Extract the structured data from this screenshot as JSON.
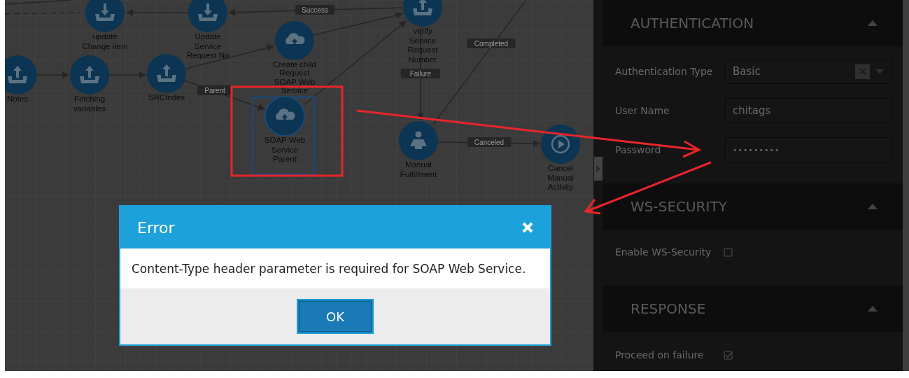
{
  "canvas": {
    "nodes": [
      {
        "label": [
          "update",
          "Change item"
        ],
        "kind": "download",
        "selected": false
      },
      {
        "label": [
          "Update",
          "Service",
          "Request No"
        ],
        "kind": "download",
        "selected": false
      },
      {
        "label": [
          "Notes"
        ],
        "kind": "upload",
        "selected": false
      },
      {
        "label": [
          "Fetching",
          "variables"
        ],
        "kind": "upload",
        "selected": false
      },
      {
        "label": [
          "SRCIndex"
        ],
        "kind": "upload",
        "selected": false
      },
      {
        "label": [
          "Create child",
          "Request",
          "SOAP Web",
          "Service"
        ],
        "kind": "cloud",
        "selected": false
      },
      {
        "label": [
          "SOAP Web",
          "Service",
          "Parent"
        ],
        "kind": "cloud",
        "selected": true
      },
      {
        "label": [
          "verify",
          "Service",
          "Request",
          "Number"
        ],
        "kind": "upload",
        "selected": false
      },
      {
        "label": [
          "Manual",
          "Fulfillment"
        ],
        "kind": "person",
        "selected": false
      },
      {
        "label": [
          "Cancel",
          "Manual",
          "Activity"
        ],
        "kind": "play",
        "selected": false
      }
    ],
    "edge_labels": [
      "Success",
      "Parent",
      "Completed",
      "Failure",
      "Canceled"
    ]
  },
  "dialog": {
    "title": "Error",
    "message": "Content-Type header parameter is required for SOAP Web Service.",
    "button": "OK"
  },
  "panel": {
    "sections": [
      {
        "title": "AUTHENTICATION",
        "expanded": true,
        "fields": [
          {
            "kind": "select",
            "label": "Authentication Type",
            "value": "Basic"
          },
          {
            "kind": "text",
            "label": "User Name",
            "value": "chitags"
          },
          {
            "kind": "password",
            "label": "Password",
            "value": "•••••••••"
          }
        ]
      },
      {
        "title": "WS-SECURITY",
        "expanded": true,
        "fields": [
          {
            "kind": "checkbox",
            "label": "Enable WS-Security",
            "checked": false
          }
        ]
      },
      {
        "title": "RESPONSE",
        "expanded": true,
        "fields": [
          {
            "kind": "checkbox",
            "label": "Proceed on failure",
            "checked": true
          }
        ]
      }
    ]
  }
}
